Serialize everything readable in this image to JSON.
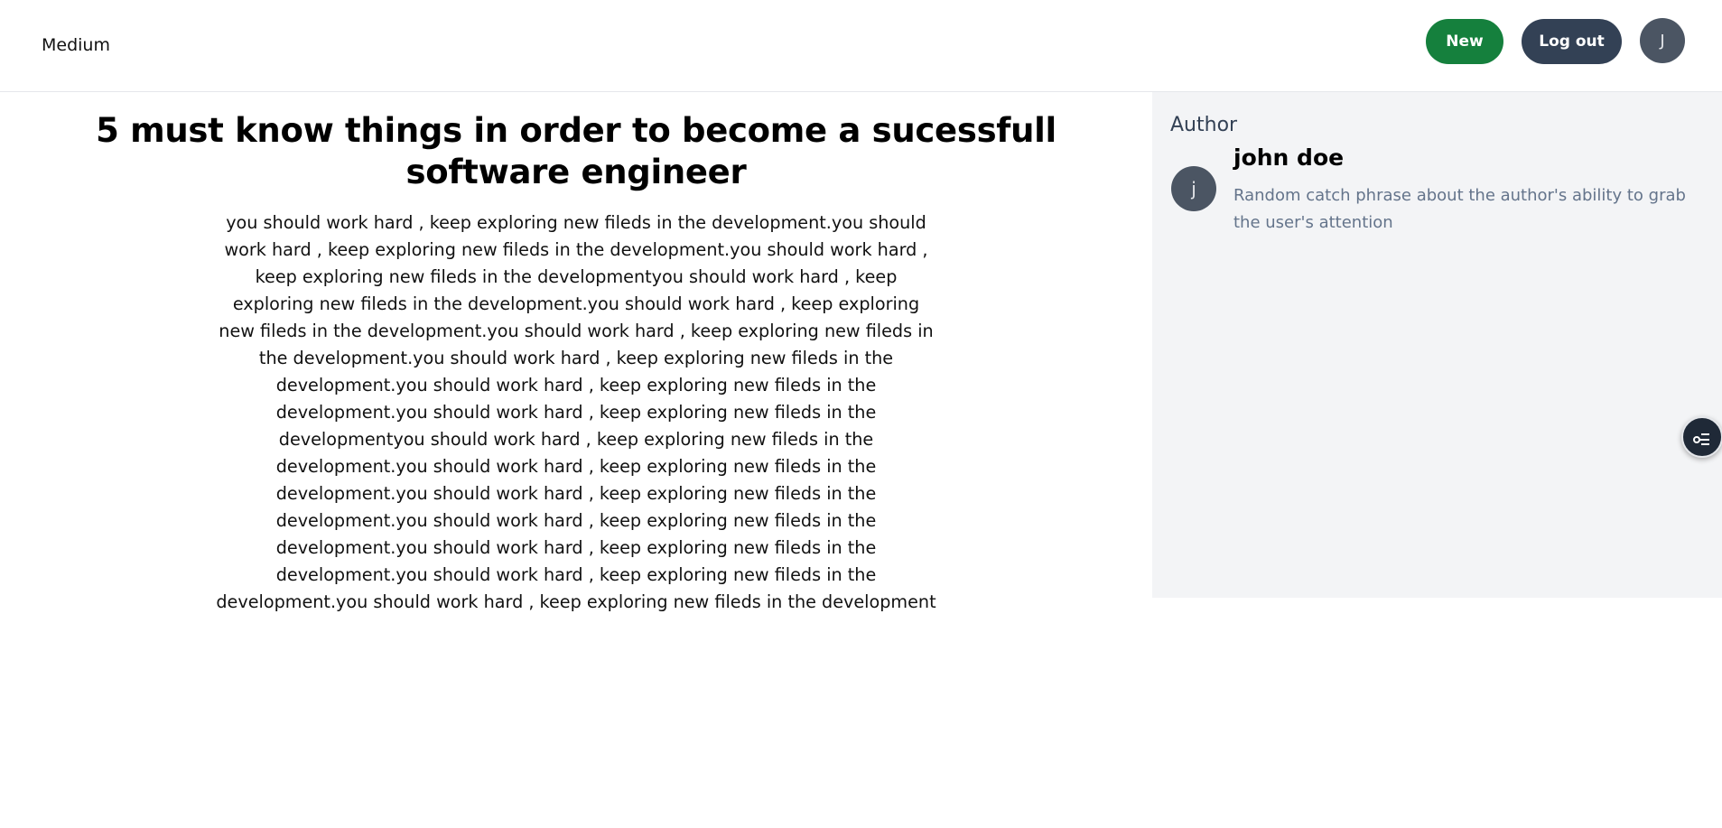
{
  "header": {
    "brand": "Medium",
    "new_label": "New",
    "logout_label": "Log out",
    "avatar_initial": "J"
  },
  "article": {
    "title": "5 must know things in order to become a sucessfull software engineer",
    "body": "you should work hard , keep exploring new fileds in the development.you should work hard , keep exploring new fileds in the development.you should work hard , keep exploring new fileds in the developmentyou should work hard , keep exploring new fileds in the development.you should work hard , keep exploring new fileds in the development.you should work hard , keep exploring new fileds in the development.you should work hard , keep exploring new fileds in the development.you should work hard , keep exploring new fileds in the development.you should work hard , keep exploring new fileds in the developmentyou should work hard , keep exploring new fileds in the development.you should work hard , keep exploring new fileds in the development.you should work hard , keep exploring new fileds in the development.you should work hard , keep exploring new fileds in the development.you should work hard , keep exploring new fileds in the development.you should work hard , keep exploring new fileds in the development.you should work hard , keep exploring new fileds in the development"
  },
  "sidebar": {
    "heading": "Author",
    "author_initial": "j",
    "author_name": "john doe",
    "author_phrase": "Random catch phrase about the author's ability to grab the user's attention"
  },
  "floating": {
    "icon": "filter-toggle-icon"
  },
  "colors": {
    "new_button": "#15803d",
    "logout_button": "#334155",
    "avatar": "#4b5563",
    "sidebar_bg": "#f3f4f6",
    "muted_text": "#64748b"
  }
}
